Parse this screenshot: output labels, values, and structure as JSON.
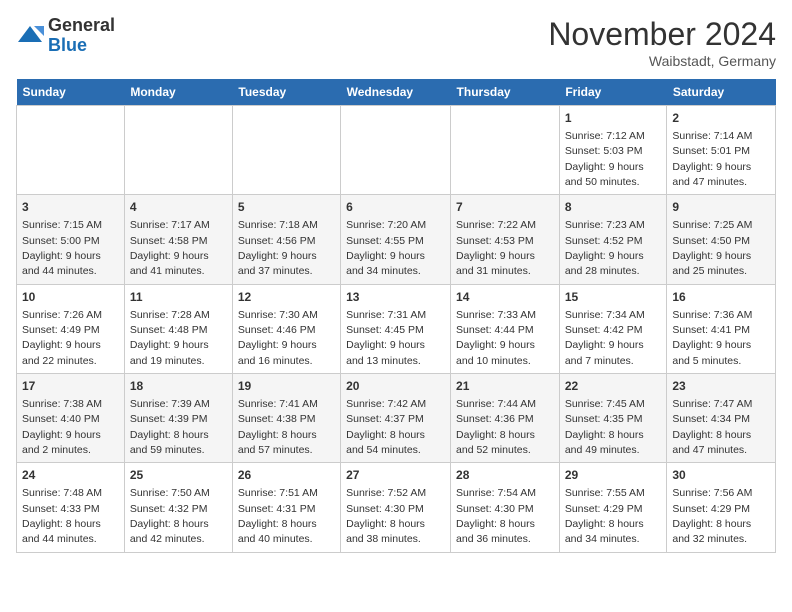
{
  "header": {
    "logo_general": "General",
    "logo_blue": "Blue",
    "month_title": "November 2024",
    "location": "Waibstadt, Germany"
  },
  "weekdays": [
    "Sunday",
    "Monday",
    "Tuesday",
    "Wednesday",
    "Thursday",
    "Friday",
    "Saturday"
  ],
  "weeks": [
    [
      {
        "day": "",
        "info": ""
      },
      {
        "day": "",
        "info": ""
      },
      {
        "day": "",
        "info": ""
      },
      {
        "day": "",
        "info": ""
      },
      {
        "day": "",
        "info": ""
      },
      {
        "day": "1",
        "info": "Sunrise: 7:12 AM\nSunset: 5:03 PM\nDaylight: 9 hours and 50 minutes."
      },
      {
        "day": "2",
        "info": "Sunrise: 7:14 AM\nSunset: 5:01 PM\nDaylight: 9 hours and 47 minutes."
      }
    ],
    [
      {
        "day": "3",
        "info": "Sunrise: 7:15 AM\nSunset: 5:00 PM\nDaylight: 9 hours and 44 minutes."
      },
      {
        "day": "4",
        "info": "Sunrise: 7:17 AM\nSunset: 4:58 PM\nDaylight: 9 hours and 41 minutes."
      },
      {
        "day": "5",
        "info": "Sunrise: 7:18 AM\nSunset: 4:56 PM\nDaylight: 9 hours and 37 minutes."
      },
      {
        "day": "6",
        "info": "Sunrise: 7:20 AM\nSunset: 4:55 PM\nDaylight: 9 hours and 34 minutes."
      },
      {
        "day": "7",
        "info": "Sunrise: 7:22 AM\nSunset: 4:53 PM\nDaylight: 9 hours and 31 minutes."
      },
      {
        "day": "8",
        "info": "Sunrise: 7:23 AM\nSunset: 4:52 PM\nDaylight: 9 hours and 28 minutes."
      },
      {
        "day": "9",
        "info": "Sunrise: 7:25 AM\nSunset: 4:50 PM\nDaylight: 9 hours and 25 minutes."
      }
    ],
    [
      {
        "day": "10",
        "info": "Sunrise: 7:26 AM\nSunset: 4:49 PM\nDaylight: 9 hours and 22 minutes."
      },
      {
        "day": "11",
        "info": "Sunrise: 7:28 AM\nSunset: 4:48 PM\nDaylight: 9 hours and 19 minutes."
      },
      {
        "day": "12",
        "info": "Sunrise: 7:30 AM\nSunset: 4:46 PM\nDaylight: 9 hours and 16 minutes."
      },
      {
        "day": "13",
        "info": "Sunrise: 7:31 AM\nSunset: 4:45 PM\nDaylight: 9 hours and 13 minutes."
      },
      {
        "day": "14",
        "info": "Sunrise: 7:33 AM\nSunset: 4:44 PM\nDaylight: 9 hours and 10 minutes."
      },
      {
        "day": "15",
        "info": "Sunrise: 7:34 AM\nSunset: 4:42 PM\nDaylight: 9 hours and 7 minutes."
      },
      {
        "day": "16",
        "info": "Sunrise: 7:36 AM\nSunset: 4:41 PM\nDaylight: 9 hours and 5 minutes."
      }
    ],
    [
      {
        "day": "17",
        "info": "Sunrise: 7:38 AM\nSunset: 4:40 PM\nDaylight: 9 hours and 2 minutes."
      },
      {
        "day": "18",
        "info": "Sunrise: 7:39 AM\nSunset: 4:39 PM\nDaylight: 8 hours and 59 minutes."
      },
      {
        "day": "19",
        "info": "Sunrise: 7:41 AM\nSunset: 4:38 PM\nDaylight: 8 hours and 57 minutes."
      },
      {
        "day": "20",
        "info": "Sunrise: 7:42 AM\nSunset: 4:37 PM\nDaylight: 8 hours and 54 minutes."
      },
      {
        "day": "21",
        "info": "Sunrise: 7:44 AM\nSunset: 4:36 PM\nDaylight: 8 hours and 52 minutes."
      },
      {
        "day": "22",
        "info": "Sunrise: 7:45 AM\nSunset: 4:35 PM\nDaylight: 8 hours and 49 minutes."
      },
      {
        "day": "23",
        "info": "Sunrise: 7:47 AM\nSunset: 4:34 PM\nDaylight: 8 hours and 47 minutes."
      }
    ],
    [
      {
        "day": "24",
        "info": "Sunrise: 7:48 AM\nSunset: 4:33 PM\nDaylight: 8 hours and 44 minutes."
      },
      {
        "day": "25",
        "info": "Sunrise: 7:50 AM\nSunset: 4:32 PM\nDaylight: 8 hours and 42 minutes."
      },
      {
        "day": "26",
        "info": "Sunrise: 7:51 AM\nSunset: 4:31 PM\nDaylight: 8 hours and 40 minutes."
      },
      {
        "day": "27",
        "info": "Sunrise: 7:52 AM\nSunset: 4:30 PM\nDaylight: 8 hours and 38 minutes."
      },
      {
        "day": "28",
        "info": "Sunrise: 7:54 AM\nSunset: 4:30 PM\nDaylight: 8 hours and 36 minutes."
      },
      {
        "day": "29",
        "info": "Sunrise: 7:55 AM\nSunset: 4:29 PM\nDaylight: 8 hours and 34 minutes."
      },
      {
        "day": "30",
        "info": "Sunrise: 7:56 AM\nSunset: 4:29 PM\nDaylight: 8 hours and 32 minutes."
      }
    ]
  ]
}
